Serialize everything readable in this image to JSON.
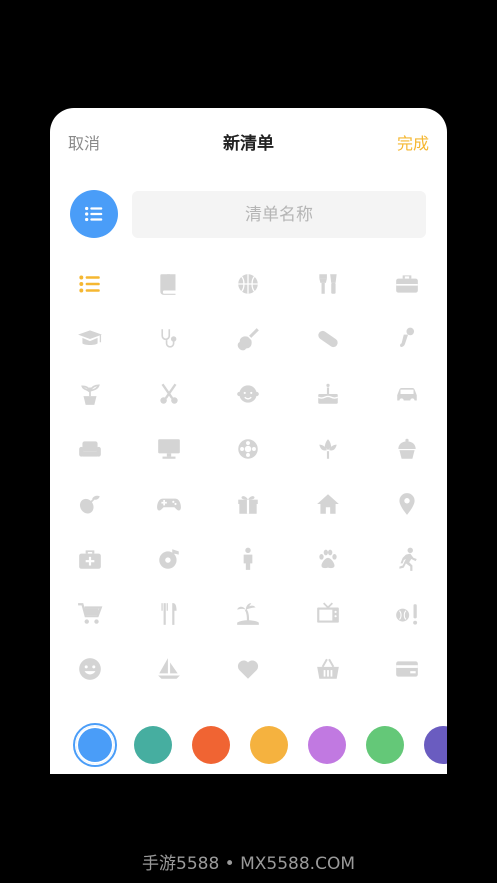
{
  "nav": {
    "cancel_label": "取消",
    "title": "新清单",
    "done_label": "完成"
  },
  "name_input": {
    "placeholder": "清单名称",
    "value": ""
  },
  "badge_icon": "list-icon",
  "icon_grid": {
    "rows": [
      [
        "list-icon",
        "book-icon",
        "basketball-icon",
        "food-drink-icon",
        "briefcase-icon"
      ],
      [
        "graduation-cap-icon",
        "stethoscope-icon",
        "guitar-icon",
        "pill-icon",
        "microphone-icon"
      ],
      [
        "plant-icon",
        "scissors-icon",
        "baby-icon",
        "birthday-cake-icon",
        "car-icon"
      ],
      [
        "sofa-icon",
        "monitor-icon",
        "film-reel-icon",
        "flower-icon",
        "cupcake-icon"
      ],
      [
        "vegetables-icon",
        "gamepad-icon",
        "gift-icon",
        "home-icon",
        "location-pin-icon"
      ],
      [
        "first-aid-kit-icon",
        "music-disc-icon",
        "person-icon",
        "paw-icon",
        "running-icon"
      ],
      [
        "shopping-cart-icon",
        "utensils-icon",
        "palm-island-icon",
        "tv-icon",
        "baseball-alert-icon"
      ],
      [
        "smiley-icon",
        "sailboat-icon",
        "heart-icon",
        "basket-icon",
        "credit-card-icon"
      ]
    ],
    "selected_icon": "list-icon",
    "selected_color": "#f5b731",
    "default_color": "#d4d4d4"
  },
  "colors": {
    "swatches": [
      "#4a9df8",
      "#46aea0",
      "#f06433",
      "#f5b23f",
      "#c179e1",
      "#64c878",
      "#6a5cc0"
    ],
    "selected_index": 0
  },
  "watermark": "手游5588 • MX5588.COM"
}
